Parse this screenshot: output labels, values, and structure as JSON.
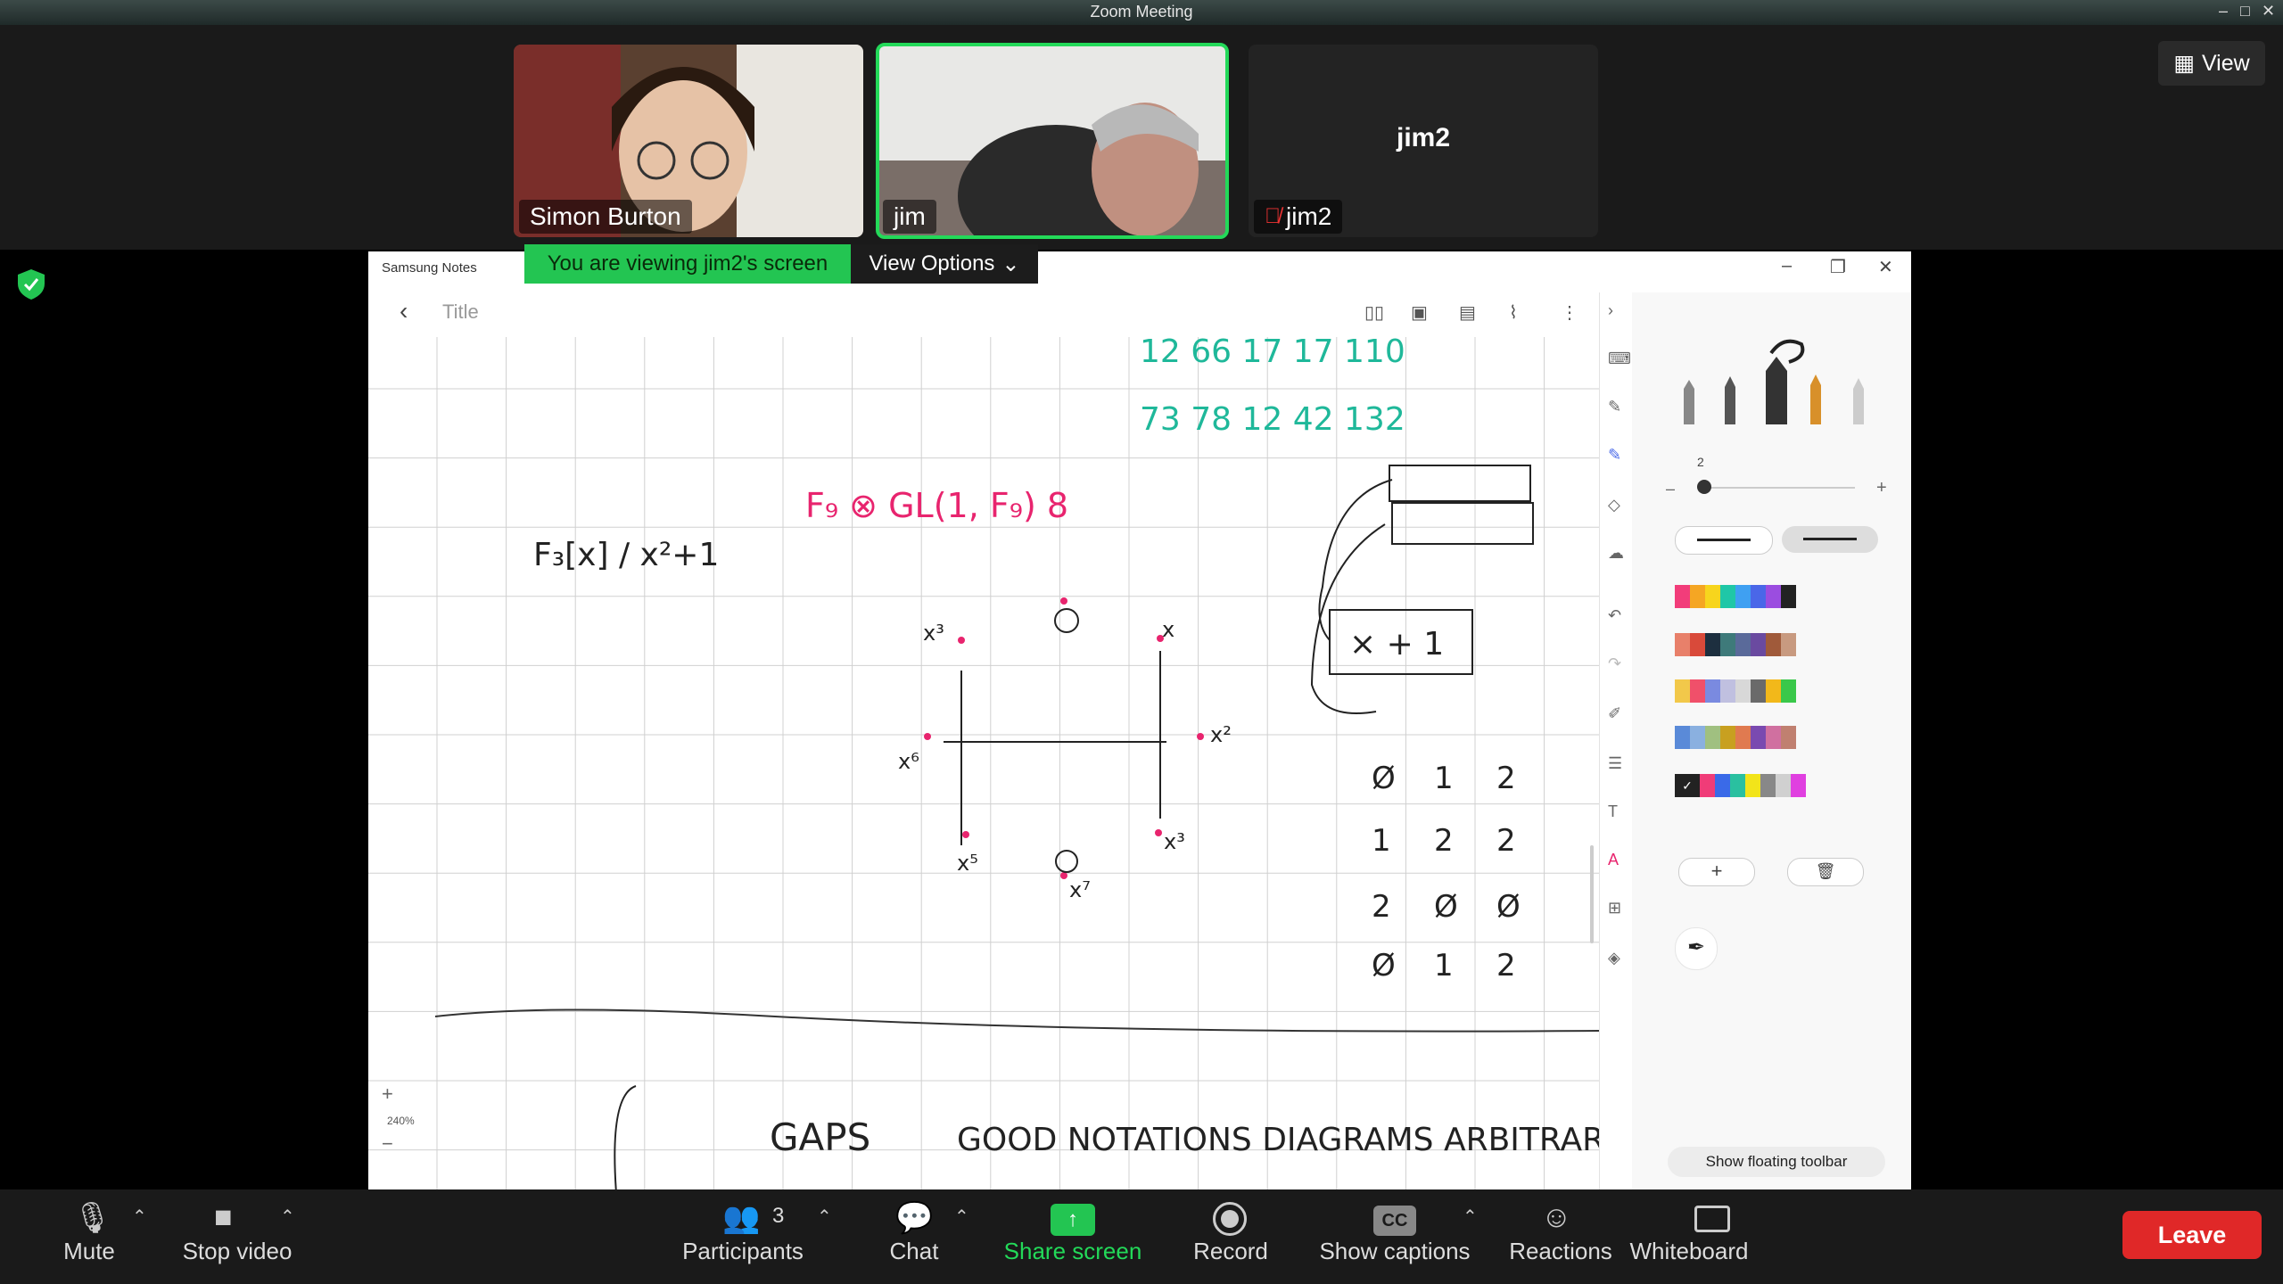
{
  "window": {
    "title": "Zoom Meeting"
  },
  "gallery": {
    "view_label": "View",
    "participants": [
      {
        "name": "Simon Burton",
        "video": true,
        "active": false
      },
      {
        "name": "jim",
        "video": true,
        "active": true
      },
      {
        "name": "jim2",
        "video": false,
        "muted": true,
        "active": false
      }
    ]
  },
  "share": {
    "banner": "You are viewing jim2's screen",
    "view_options": "View Options"
  },
  "notes": {
    "app_title": "Samsung Notes",
    "note_title_placeholder": "Title",
    "zoom_level": "240%",
    "zoom_in": "+",
    "zoom_out": "−",
    "pen_size": "2",
    "float_toolbar": "Show floating toolbar",
    "handwriting_top": [
      "12 66 17 17 110",
      "73 78 12 42 132"
    ],
    "handwriting_table": [
      [
        "Ø",
        "1",
        "2"
      ],
      [
        "1",
        "2",
        "2"
      ],
      [
        "2",
        "Ø",
        "Ø"
      ],
      [
        "Ø",
        "1",
        "2"
      ]
    ],
    "handwriting_labels": [
      "F₉ ⊗ GL(1, F₉) 8",
      "F₃[x] / x²+1",
      "x³",
      "x",
      "x²",
      "x⁶",
      "x⁵",
      "x⁷",
      "x³",
      "GAPS",
      "GOOD NOTATIONS  DIAGRAMS  ARBITRARY"
    ],
    "swatches": [
      [
        "#f23d7a",
        "#f5a623",
        "#f7d51d",
        "#1fc7a7",
        "#3fa0f2",
        "#4a67e8",
        "#9b4de0",
        "#222222"
      ],
      [
        "#e8806a",
        "#d94a3a",
        "#1d2f3f",
        "#3e7a7a",
        "#5a6a9a",
        "#6a4aa0",
        "#a05a3a",
        "#c89a80"
      ],
      [
        "#f2c84a",
        "#f0506a",
        "#7a8ae0",
        "#c0c0e0",
        "#d8d8d8",
        "#6a6a6a",
        "#f2b81a",
        "#3ac84a"
      ],
      [
        "#5a8ad8",
        "#8ab0e0",
        "#a0c080",
        "#c8a020",
        "#e07a50",
        "#7a4ab0",
        "#d070a0",
        "#c08070"
      ],
      [
        "#222222",
        "#f03c78",
        "#3a6ae8",
        "#2ac0a0",
        "#f2e41a",
        "#888888",
        "#d0d0d0",
        "#e040e0"
      ]
    ]
  },
  "toolbar": {
    "mute": "Mute",
    "stop_video": "Stop video",
    "participants": "Participants",
    "participant_count": "3",
    "chat": "Chat",
    "share_screen": "Share screen",
    "record": "Record",
    "show_captions": "Show captions",
    "reactions": "Reactions",
    "whiteboard": "Whiteboard",
    "leave": "Leave"
  },
  "colors": {
    "accent_green": "#23d959",
    "leave_red": "#e02828",
    "ink_pink": "#e8246e",
    "ink_teal": "#1fb89a"
  }
}
